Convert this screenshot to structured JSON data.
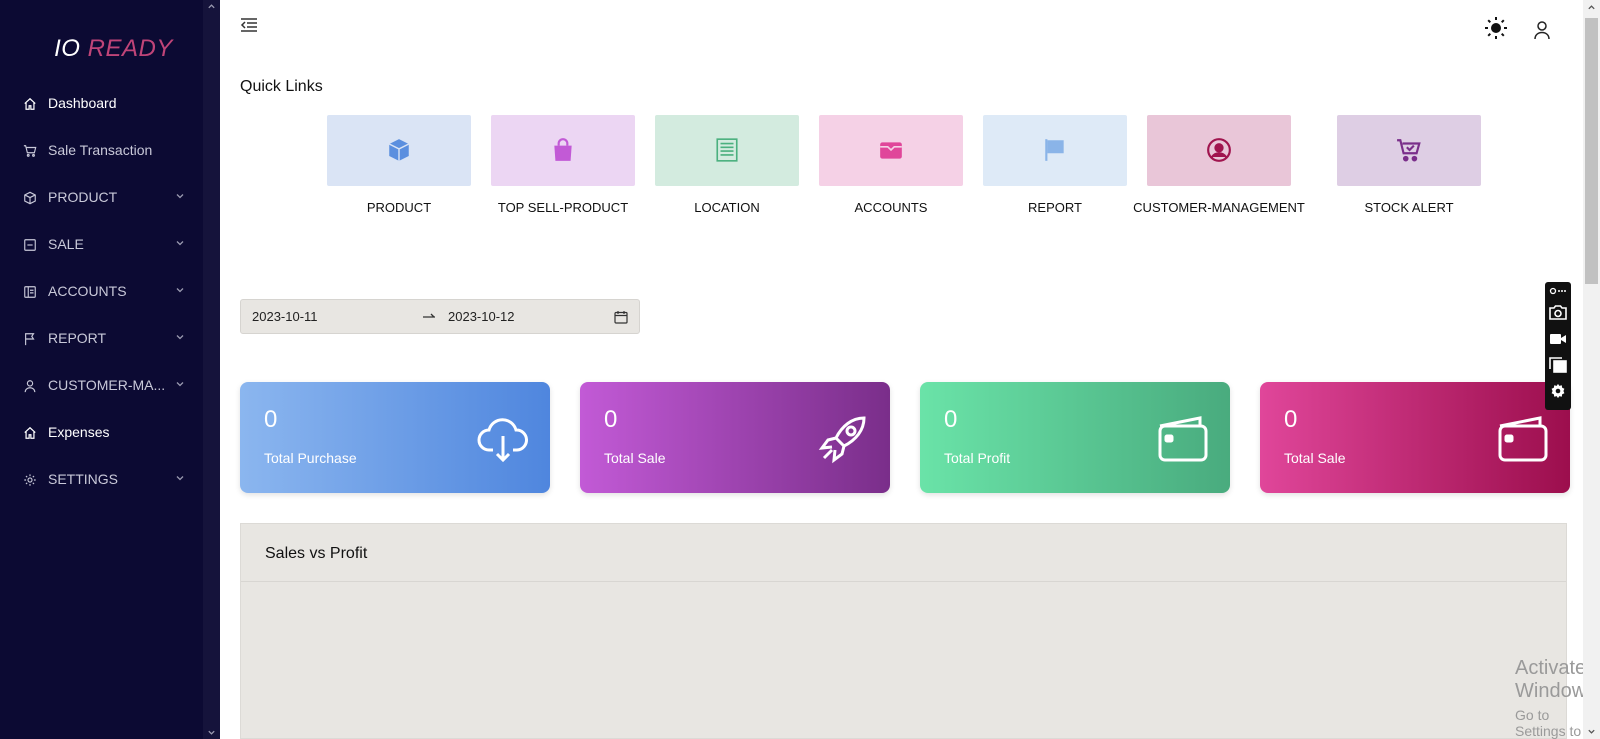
{
  "brand": {
    "part1": "IO",
    "part2": "READY",
    "accent": "#c04478"
  },
  "sidebar": {
    "items": [
      {
        "label": "Dashboard",
        "icon": "home-icon",
        "active": true
      },
      {
        "label": "Sale Transaction",
        "icon": "cart-icon"
      },
      {
        "label": "PRODUCT",
        "icon": "cube-icon",
        "expandable": true
      },
      {
        "label": "SALE",
        "icon": "minus-square-icon",
        "expandable": true
      },
      {
        "label": "ACCOUNTS",
        "icon": "ledger-icon",
        "expandable": true
      },
      {
        "label": "REPORT",
        "icon": "flag-icon",
        "expandable": true
      },
      {
        "label": "CUSTOMER-MA...",
        "icon": "user-icon",
        "expandable": true
      },
      {
        "label": "Expenses",
        "icon": "home-icon",
        "active": true
      },
      {
        "label": "SETTINGS",
        "icon": "gear-icon",
        "expandable": true
      }
    ]
  },
  "header": {
    "theme_icon": "sun-icon",
    "profile_icon": "user-icon"
  },
  "quick_links": {
    "title": "Quick Links",
    "items": [
      {
        "label": "PRODUCT",
        "icon": "cube-icon",
        "bg": "#dae4f5",
        "color": "#5b8fdf"
      },
      {
        "label": "TOP SELL-PRODUCT",
        "icon": "shopping-bag-icon",
        "bg": "#ecd6f3",
        "color": "#c25ad6"
      },
      {
        "label": "LOCATION",
        "icon": "list-icon",
        "bg": "#d3ebdf",
        "color": "#4bb07f"
      },
      {
        "label": "ACCOUNTS",
        "icon": "wallet-icon",
        "bg": "#f5d1e6",
        "color": "#e0469a"
      },
      {
        "label": "REPORT",
        "icon": "flag-icon",
        "bg": "#deeaf7",
        "color": "#8ab4e8"
      },
      {
        "label": "CUSTOMER-MANAGEMENT",
        "icon": "user-circle-icon",
        "bg": "#e9c6d8",
        "color": "#a0144e"
      },
      {
        "label": "STOCK ALERT",
        "icon": "cart-check-icon",
        "bg": "#decee4",
        "color": "#7a2e8a"
      }
    ]
  },
  "date_range": {
    "start": "2023-10-11",
    "end": "2023-10-12"
  },
  "stats": [
    {
      "value": "0",
      "label": "Total Purchase",
      "icon": "cloud-download-icon",
      "from": "#8bb6ef",
      "to": "#4f86de"
    },
    {
      "value": "0",
      "label": "Total Sale",
      "icon": "rocket-icon",
      "from": "#c25ad6",
      "to": "#7a2e8a"
    },
    {
      "value": "0",
      "label": "Total Profit",
      "icon": "wallet-icon",
      "from": "#6ae3a8",
      "to": "#49ab7e"
    },
    {
      "value": "0",
      "label": "Total Sale",
      "icon": "wallet-icon",
      "from": "#e0469a",
      "to": "#9c0e4d"
    }
  ],
  "panel": {
    "title": "Sales vs Profit"
  },
  "watermark": {
    "line1": "Activate Windows",
    "line2": "Go to Settings to activate Windows."
  }
}
